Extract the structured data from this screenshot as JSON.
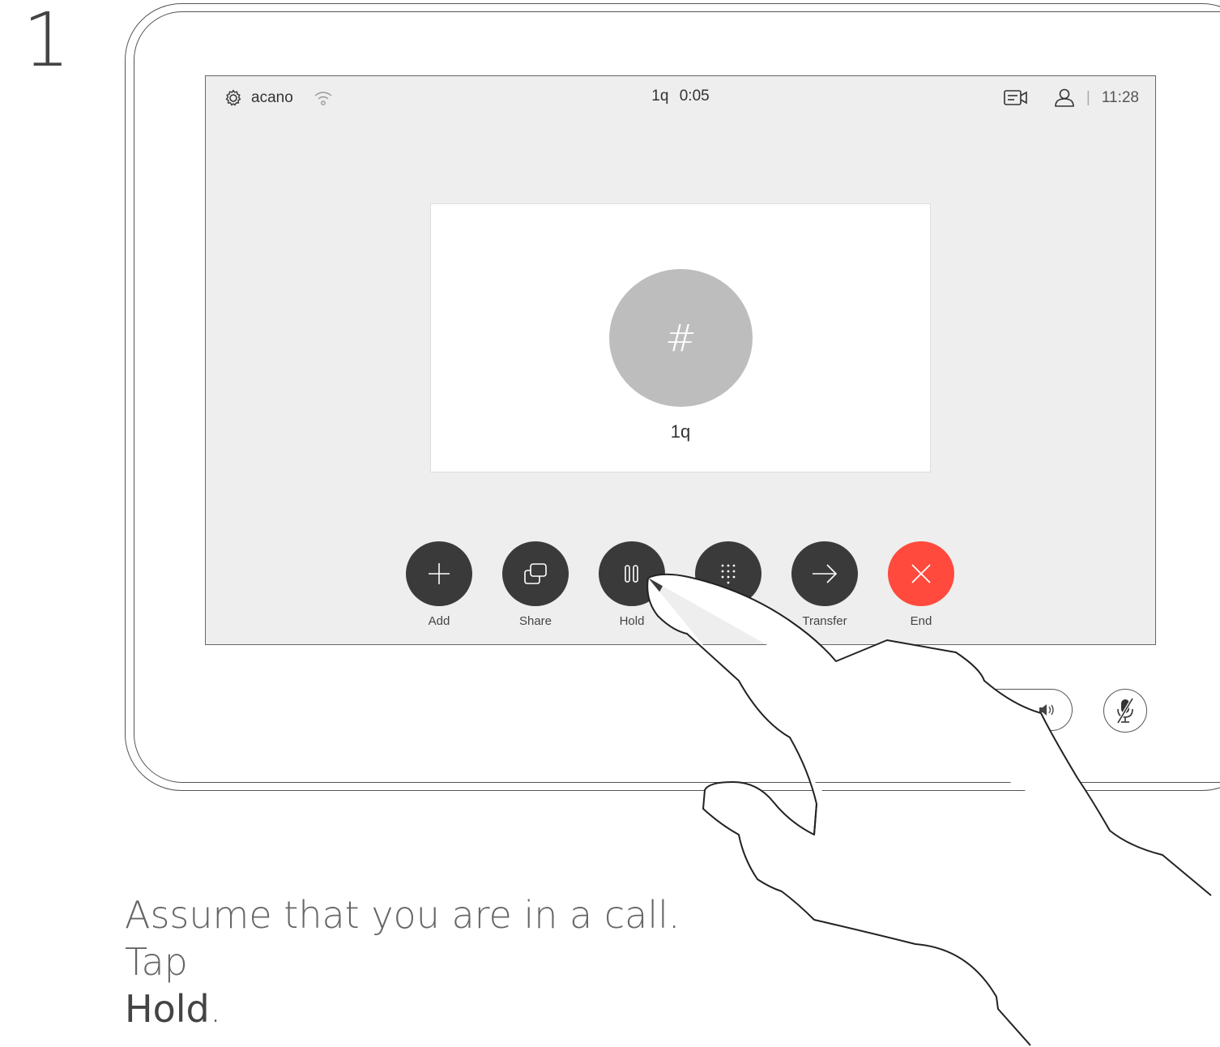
{
  "step": {
    "number": "1"
  },
  "status_bar": {
    "settings_label": "acano",
    "call_name": "1q",
    "call_duration": "0:05",
    "separator": "|",
    "time": "11:28"
  },
  "call": {
    "avatar_glyph": "#",
    "caller_name": "1q"
  },
  "controls": [
    {
      "label": "Add",
      "icon": "plus-icon"
    },
    {
      "label": "Share",
      "icon": "share-icon"
    },
    {
      "label": "Hold",
      "icon": "pause-icon"
    },
    {
      "label": "",
      "icon": "keypad-icon"
    },
    {
      "label": "Transfer",
      "icon": "arrow-right-icon"
    },
    {
      "label": "End",
      "icon": "close-icon"
    }
  ],
  "colors": {
    "end_red": "#ff4a3d",
    "button_dark": "#3a3a3a",
    "screen_bg": "#eeeeee"
  },
  "instruction": {
    "text": "Assume that you are in a call. Tap ",
    "emphasis": "Hold",
    "suffix": "."
  }
}
